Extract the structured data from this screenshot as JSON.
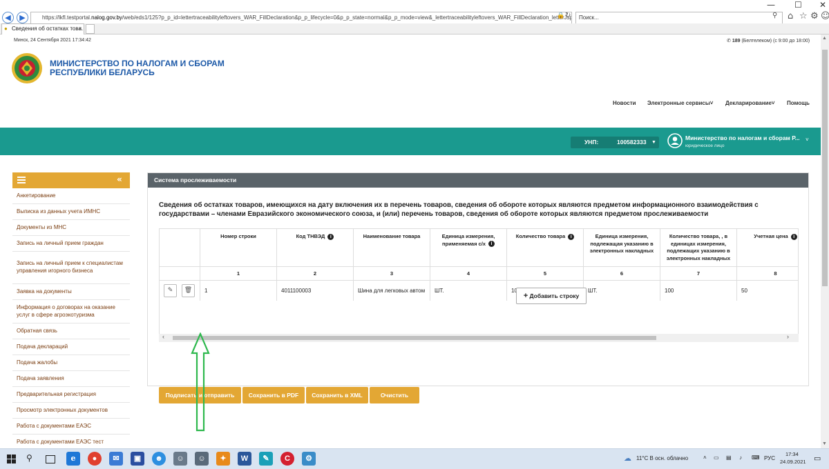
{
  "browser": {
    "url_prefix": "https://lkfl.testportal.",
    "url_host": "nalog.gov.by",
    "url_rest": "/web/eds1/125?p_p_id=lettertraceabilityleftovers_WAR_FillDeclaration&p_p_lifecycle=0&p_p_state=normal&p_p_mode=view&_lettertraceabilityleftovers_WAR_FillDeclaration_letterJspPage=",
    "search_placeholder": "Поиск...",
    "tab_title": "Сведения об остатках това..."
  },
  "header": {
    "date": "Минск, 24 Сентября 2021 17:34:42",
    "phone_number": "189",
    "phone_text": "(Белтелеком) (с 9:00 до 18:00)",
    "title_line1": "МИНИСТЕРСТВО ПО НАЛОГАМ И СБОРАМ",
    "title_line2": "РЕСПУБЛИКИ БЕЛАРУСЬ",
    "nav": [
      "Новости",
      "Электронные сервисы",
      "Декларирование",
      "Помощь"
    ]
  },
  "teal_bar": {
    "unp_label": "УНП:",
    "unp_value": "100582333",
    "user_name": "Министерство по налогам и сборам Р...",
    "user_type": "юридическое лицо"
  },
  "sidebar": {
    "items": [
      "Анкетирование",
      "Выписка из данных учета ИМНС",
      "Документы из МНС",
      "Запись на личный прием граждан",
      "Запись на личный прием к специалистам управления игорного бизнеса",
      "Заявка на документы",
      "Информация о договорах на оказание услуг в сфере агроэкотуризма",
      "Обратная связь",
      "Подача деклараций",
      "Подача жалобы",
      "Подача заявления",
      "Предварительная регистрация",
      "Просмотр электронных документов",
      "Работа с документами ЕАЭС",
      "Работа с документами ЕАЭС тест"
    ]
  },
  "panel": {
    "title": "Система прослеживаемости",
    "description": "Сведения об остатках товаров, имеющихся на дату включения их в перечень товаров, сведения об обороте которых являются предметом информационного взаимодействия с государствами – членами Евразийского экономического союза, и (или) перечень товаров, сведения об обороте которых являются предметом прослеживаемости",
    "columns": [
      "Номер строки",
      "Код ТНВЭД",
      "Наименование товара",
      "Единица измерения, применяемая с/х",
      "Количество товара",
      "Единица измерения, подлежащая указанию в электронных накладных",
      "Количество товара, , в единицах измерения, подлежащих указанию в электронных накладных",
      "Учетная цена"
    ],
    "column_numbers": [
      "1",
      "2",
      "3",
      "4",
      "5",
      "6",
      "7",
      "8"
    ],
    "row": [
      "1",
      "4011100003",
      "Шина для легковых автом",
      "ШТ.",
      "100",
      "ШТ.",
      "100",
      "50"
    ],
    "add_row_label": "Добавить строку",
    "buttons": [
      "Подписать и отправить",
      "Сохранить в PDF",
      "Сохранить в XML",
      "Очистить"
    ]
  },
  "taskbar": {
    "weather": "11°C  В осн. облачно",
    "lang": "РУС",
    "time": "17:34",
    "date": "24.09.2021"
  },
  "colors": {
    "teal": "#1a9a8f",
    "gold": "#e3a734",
    "panel_header": "#5a6369",
    "arrow": "#2db84d"
  }
}
